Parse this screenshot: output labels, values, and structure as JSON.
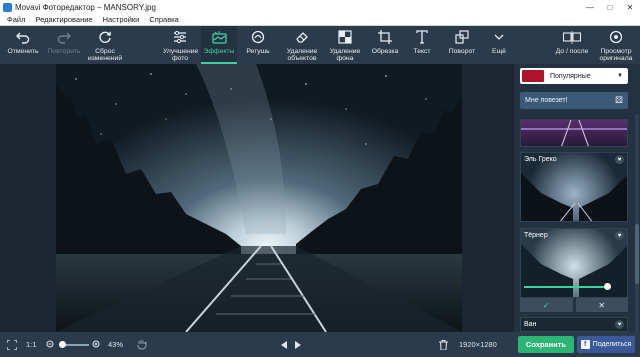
{
  "window": {
    "title": "Movavi Фоторедактор – MANSORY.jpg"
  },
  "menu": [
    "Файл",
    "Редактирование",
    "Настройки",
    "Справка"
  ],
  "toolbar": {
    "undo": "Отменить",
    "redo": "Повторить",
    "reset": "Сброс изменений",
    "enhance": "Улучшение фото",
    "effects": "Эффекты",
    "retouch": "Ретушь",
    "remove_objects": "Удаление объектов",
    "remove_bg": "Удаление фона",
    "crop": "Обрезка",
    "text": "Текст",
    "rotate": "Поворот",
    "more": "Ещё",
    "before_after": "До / после",
    "view_original": "Просмотр оригинала"
  },
  "effects_panel": {
    "category": "Популярные",
    "lucky": "Мне повезет!",
    "items": [
      "Эль Греко",
      "Тёрнер",
      "Ван"
    ],
    "accent": "#3fd1a6"
  },
  "status": {
    "fit": "1:1",
    "zoom": "43%",
    "dimensions": "1920×1280",
    "save": "Сохранить",
    "share": "Поделиться",
    "share_color": "#3b5998"
  },
  "icons": [
    "undo-icon",
    "redo-icon",
    "reset-icon",
    "enhance-icon",
    "effects-icon",
    "retouch-icon",
    "eraser-icon",
    "remove-bg-icon",
    "crop-icon",
    "text-icon",
    "rotate-icon",
    "chevron-down-icon",
    "before-after-icon",
    "eye-icon",
    "fullscreen-icon",
    "zoom-out-icon",
    "zoom-in-icon",
    "hand-icon",
    "prev-icon",
    "next-icon",
    "trash-icon",
    "heart-icon",
    "dice-icon",
    "check-icon",
    "close-icon"
  ]
}
